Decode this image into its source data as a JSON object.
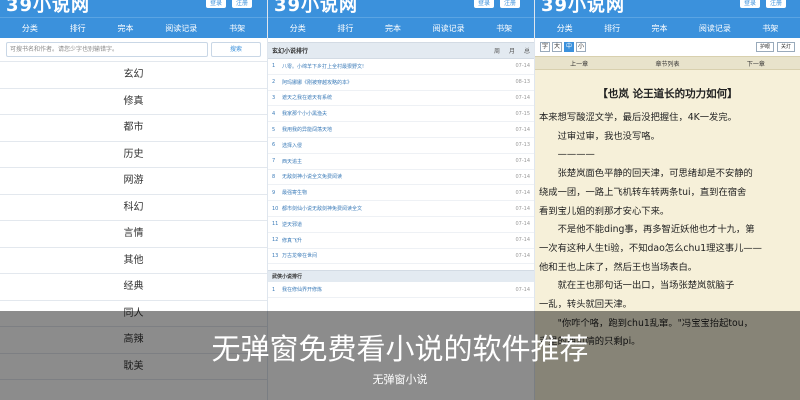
{
  "site": {
    "logo": "39小说网"
  },
  "top_buttons": [
    "登录",
    "注册"
  ],
  "nav": [
    "分类",
    "排行",
    "完本",
    "阅读记录",
    "书架"
  ],
  "search": {
    "placeholder": "可搜书名和作者。请您少字也别输错字。",
    "button": "搜索"
  },
  "categories": [
    "玄幻",
    "修真",
    "都市",
    "历史",
    "网游",
    "科幻",
    "言情",
    "其他",
    "经典",
    "同人",
    "高辣",
    "耽美"
  ],
  "ranking": {
    "title": "玄幻小说排行",
    "tabs": [
      "周",
      "月",
      "总"
    ],
    "items": [
      {
        "num": "1",
        "title": "八零。小绵羊下乡打上全村最狠野文!",
        "date": "07-14"
      },
      {
        "num": "2",
        "title": "阿玛娜娜《刚被穿越攻略的本》",
        "date": "08-13"
      },
      {
        "num": "3",
        "title": "遮天之我在遮天有系统",
        "date": "07-14"
      },
      {
        "num": "4",
        "title": "我家那个小小黑渔夫",
        "date": "07-15"
      },
      {
        "num": "5",
        "title": "我用我的异能闯荡天地",
        "date": "07-14"
      },
      {
        "num": "6",
        "title": "选择入侵",
        "date": "07-13"
      },
      {
        "num": "7",
        "title": "西天追主",
        "date": "07-14"
      },
      {
        "num": "8",
        "title": "无敌剑神小说全文免费阅读",
        "date": "07-14"
      },
      {
        "num": "9",
        "title": "最强寄生物",
        "date": "07-14"
      },
      {
        "num": "10",
        "title": "都市剑仙小说无敌剑神免费阅读全文",
        "date": "07-14"
      },
      {
        "num": "11",
        "title": "逆天邪道",
        "date": "07-14"
      },
      {
        "num": "12",
        "title": "修真飞升",
        "date": "07-14"
      },
      {
        "num": "13",
        "title": "万古龙帝在世间",
        "date": "07-14"
      }
    ],
    "second_title": "武侠小说排行",
    "second_items": [
      {
        "num": "1",
        "title": "我在修仙界开修炼",
        "date": "07-14"
      }
    ]
  },
  "reader": {
    "font_buttons": [
      "字",
      "大",
      "中",
      "小"
    ],
    "page_buttons": [
      "护眼",
      "关灯"
    ],
    "nav": [
      "上一章",
      "章节列表",
      "下一章"
    ],
    "chapter_title": "【也岚 论王道长的功力如何】",
    "paragraphs": [
      {
        "text": "本来想写酸涩文学，最后没把握住，4K一发完。",
        "indent": false
      },
      {
        "text": "过审过审，我也没写咯。",
        "indent": true
      },
      {
        "text": "————",
        "indent": true
      },
      {
        "text": "张楚岚面色平静的回天津，可思绪却是不安静的",
        "indent": true
      },
      {
        "text": "绕成一团，一路上飞机转车转两条tui，直到在宿舍",
        "indent": false
      },
      {
        "text": "看到宝儿姐的刹那才安心下来。",
        "indent": false
      },
      {
        "text": "不是他不能ding事，再多智近妖他也才十九，第",
        "indent": true
      },
      {
        "text": "一次有这种人生ti验，不知dao怎么chu1理这事儿——",
        "indent": false
      },
      {
        "text": "他和王也上床了，然后王也当场表白。",
        "indent": false
      },
      {
        "text": "就在王也那句话一出口，当场张楚岚就脑子",
        "indent": true
      },
      {
        "text": "一乱，转头就回天津。",
        "indent": false
      },
      {
        "text": "\"你咋个咯，跑到chu1乱窜。\"冯宝宝抬起tou，",
        "indent": true
      },
      {
        "text": "手里的西瓜啃的只剩pi。",
        "indent": false
      }
    ]
  },
  "overlay": {
    "title": "无弹窗免费看小说的软件推荐",
    "subtitle": "无弹窗小说"
  }
}
